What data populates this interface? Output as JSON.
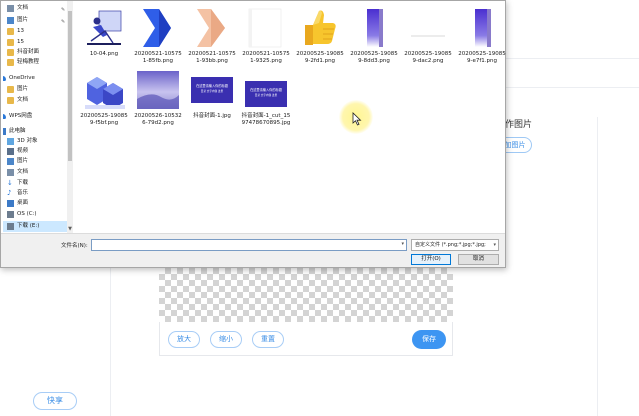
{
  "page": {
    "upload_label": "作图片",
    "upload_button": "加图片",
    "toolbar": {
      "zoom_in": "放大",
      "zoom_out": "缩小",
      "reset": "重置",
      "save": "保存"
    },
    "share_button": "快享"
  },
  "dialog": {
    "sidebar": [
      {
        "label": "文档",
        "icon": "document-icon",
        "pinned": true
      },
      {
        "label": "图片",
        "icon": "picture-icon",
        "pinned": true
      },
      {
        "label": "13",
        "icon": "folder-icon"
      },
      {
        "label": "15",
        "icon": "folder-icon"
      },
      {
        "label": "抖音封面",
        "icon": "folder-icon"
      },
      {
        "label": "轻梅教程",
        "icon": "folder-icon"
      },
      {
        "label": "OneDrive",
        "icon": "cloud-icon"
      },
      {
        "label": "图片",
        "icon": "folder-icon"
      },
      {
        "label": "文档",
        "icon": "folder-icon"
      },
      {
        "label": "WPS网盘",
        "icon": "cloud-drive-icon"
      },
      {
        "label": "此电脑",
        "icon": "computer-icon"
      },
      {
        "label": "3D 对象",
        "icon": "cube-icon"
      },
      {
        "label": "视频",
        "icon": "video-icon"
      },
      {
        "label": "图片",
        "icon": "picture-icon"
      },
      {
        "label": "文档",
        "icon": "document-icon"
      },
      {
        "label": "下载",
        "icon": "download-icon"
      },
      {
        "label": "音乐",
        "icon": "music-icon"
      },
      {
        "label": "桌面",
        "icon": "desktop-icon"
      },
      {
        "label": "OS (C:)",
        "icon": "drive-icon"
      },
      {
        "label": "下载 (E:)",
        "icon": "drive-icon",
        "selected": true
      }
    ],
    "files": [
      {
        "name": "10-04.png",
        "thumb": "illustration"
      },
      {
        "name": "20200521-105751-85fb.png",
        "thumb": "blue-chevron"
      },
      {
        "name": "20200521-105751-93bb.png",
        "thumb": "peach-chevron"
      },
      {
        "name": "20200521-105751-9325.png",
        "thumb": "blank"
      },
      {
        "name": "20200525-190859-2fd1.png",
        "thumb": "thumbs-up"
      },
      {
        "name": "20200525-190859-8dd3.png",
        "thumb": "purple-bar"
      },
      {
        "name": "20200525-190859-dac2.png",
        "thumb": "gray-line"
      },
      {
        "name": "20200525-190859-e7f1.png",
        "thumb": "purple-bar-2"
      },
      {
        "name": "20200525-190859-f5bf.png",
        "thumb": "cubes"
      },
      {
        "name": "20200526-105326-79d2.png",
        "thumb": "photo"
      },
      {
        "name": "抖音封面-1.jpg",
        "thumb": "cover",
        "caption_lines": [
          "在这里请输入你的标题",
          "目录 文字内容 这里"
        ]
      },
      {
        "name": "抖音封面-1_cut_1597478670895.jpg",
        "thumb": "cover-cut",
        "caption_lines": [
          "在这里请输入你的标题",
          "目录 文字内容 这里"
        ]
      }
    ],
    "filename_label": "文件名(N):",
    "filename_value": "",
    "filter_value": "自定义文件 (*.png;*.jpg;*.jpg;",
    "open_button": "打开(O)",
    "cancel_button": "取消"
  },
  "colors": {
    "accent": "#3d95f2",
    "selection": "#cce8ff",
    "cover_bg": "#3a2fb0",
    "purple": "#5a2fd6"
  }
}
